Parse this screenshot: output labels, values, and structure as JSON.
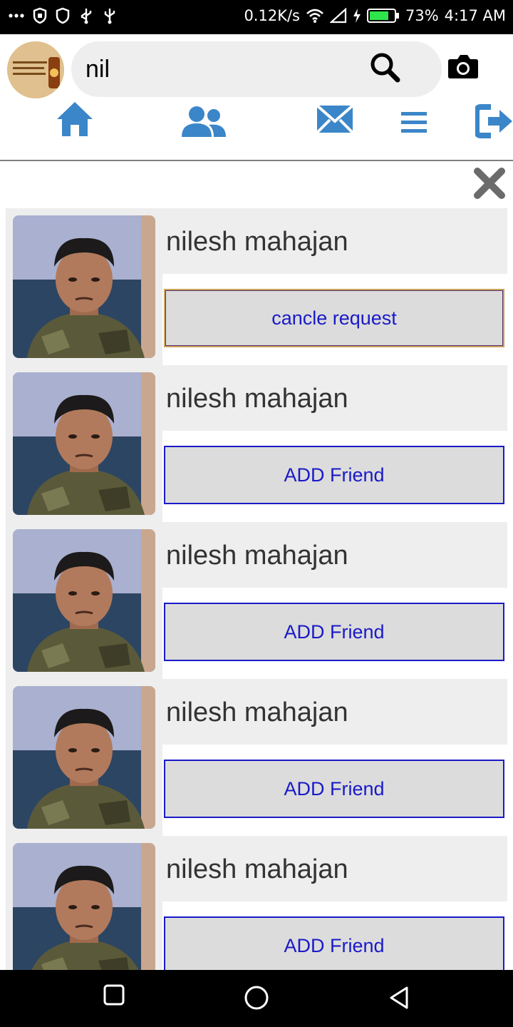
{
  "status_bar": {
    "network_speed": "0.12K/s",
    "battery": "73%",
    "time": "4:17 AM",
    "icons": [
      "more-icon",
      "shield-icon",
      "shield-outline-icon",
      "usb-icon",
      "usb-icon",
      "wifi-icon",
      "signal-icon",
      "charging-icon",
      "battery-icon"
    ]
  },
  "header": {
    "search": {
      "value": "nil"
    },
    "icons": [
      "search-icon",
      "camera-icon"
    ]
  },
  "nav": {
    "items": [
      "home-icon",
      "friends-icon",
      "messages-icon",
      "menu-icon",
      "logout-icon"
    ],
    "accent_color": "#3b86c8"
  },
  "results": {
    "items": [
      {
        "name": "nilesh mahajan",
        "action": "cancle request"
      },
      {
        "name": "nilesh mahajan",
        "action": "ADD Friend"
      },
      {
        "name": "nilesh mahajan",
        "action": "ADD Friend"
      },
      {
        "name": "nilesh mahajan",
        "action": "ADD Friend"
      },
      {
        "name": "nilesh mahajan",
        "action": "ADD Friend"
      }
    ]
  },
  "colors": {
    "button_text": "#1a1ac8",
    "card_bg": "#eeeeee",
    "button_bg": "#dcdcdc"
  }
}
